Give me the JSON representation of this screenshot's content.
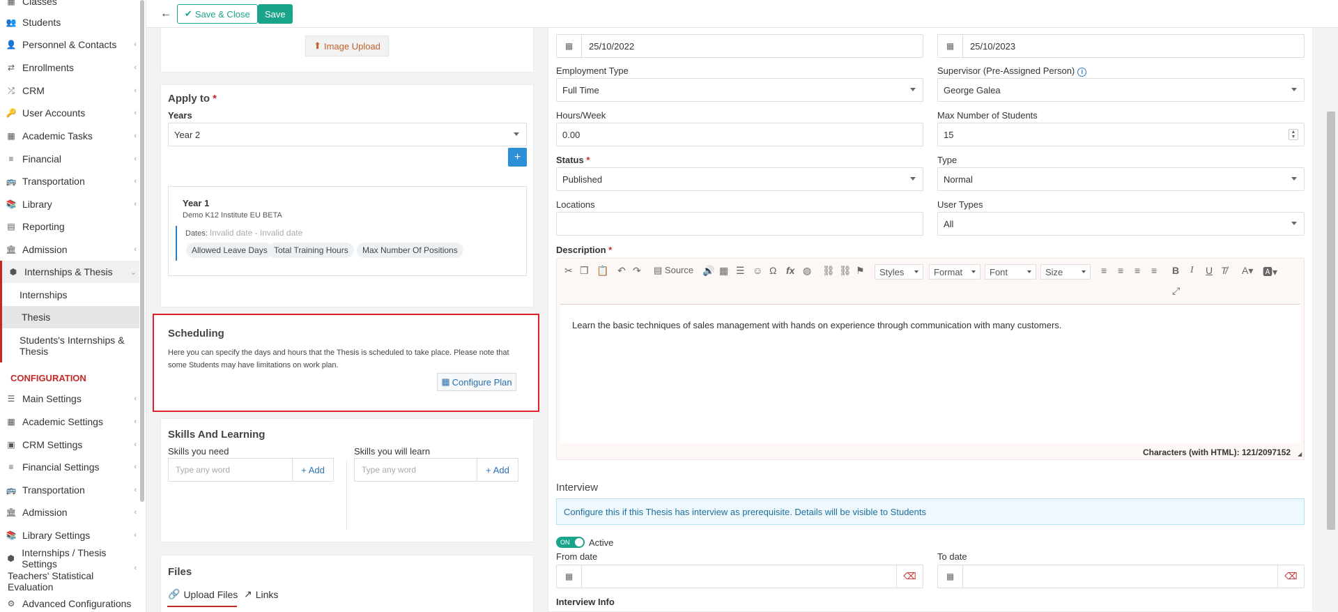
{
  "sidebar": {
    "top_partial_item": "Classes",
    "items": [
      {
        "label": "Students",
        "icon": "users-icon"
      },
      {
        "label": "Personnel & Contacts",
        "icon": "person-icon"
      },
      {
        "label": "Enrollments",
        "icon": "exchange-icon"
      },
      {
        "label": "CRM",
        "icon": "shuffle-icon"
      },
      {
        "label": "User Accounts",
        "icon": "key-icon"
      },
      {
        "label": "Academic Tasks",
        "icon": "grid-icon"
      },
      {
        "label": "Financial",
        "icon": "coins-icon"
      },
      {
        "label": "Transportation",
        "icon": "bus-icon"
      },
      {
        "label": "Library",
        "icon": "books-icon"
      },
      {
        "label": "Reporting",
        "icon": "report-icon"
      },
      {
        "label": "Admission",
        "icon": "bank-icon"
      },
      {
        "label": "Internships & Thesis",
        "icon": "cube-icon"
      }
    ],
    "sub_items": [
      "Internships",
      "Thesis",
      "Students's Internships &",
      "Thesis"
    ],
    "config_title": "CONFIGURATION",
    "config_items": [
      {
        "label": "Main Settings",
        "icon": "sliders-icon"
      },
      {
        "label": "Academic Settings",
        "icon": "grid-icon"
      },
      {
        "label": "CRM Settings",
        "icon": "crm-icon"
      },
      {
        "label": "Financial Settings",
        "icon": "coins-icon"
      },
      {
        "label": "Transportation",
        "icon": "bus-icon"
      },
      {
        "label": "Admission",
        "icon": "bank-icon"
      },
      {
        "label": "Library Settings",
        "icon": "books-icon"
      },
      {
        "label": "Internships / Thesis Settings",
        "icon": "cube-icon"
      },
      {
        "label": "Teachers' Statistical Evaluation",
        "icon": ""
      },
      {
        "label": "Advanced Configurations",
        "icon": "gears-icon"
      }
    ]
  },
  "toolbar": {
    "save_close_label": "Save & Close",
    "save_label": "Save"
  },
  "image_upload_label": "Image Upload",
  "apply_to": {
    "title": "Apply to",
    "years_label": "Years",
    "years_value": "Year 2",
    "card": {
      "title": "Year 1",
      "institute": "Demo K12 Institute EU BETA",
      "dates_label": "Dates:",
      "dates_value": "Invalid date - Invalid date",
      "chips": [
        "Allowed Leave Days",
        "Total Training Hours",
        "Max Number Of Positions"
      ]
    }
  },
  "scheduling": {
    "title": "Scheduling",
    "desc1": "Here you can specify the days and hours that the Thesis is scheduled to take place. Please note that",
    "desc2": "some Students may have limitations on work plan.",
    "configure_label": "Configure Plan"
  },
  "skills": {
    "title": "Skills And Learning",
    "need_label": "Skills you need",
    "learn_label": "Skills you will learn",
    "placeholder": "Type any word",
    "add_label": "Add"
  },
  "files": {
    "title": "Files",
    "tab_upload": "Upload Files",
    "tab_links": "Links"
  },
  "form": {
    "start_date": "25/10/2022",
    "end_date": "25/10/2023",
    "employment_type_label": "Employment Type",
    "employment_type_value": "Full Time",
    "supervisor_label": "Supervisor (Pre-Assigned Person)",
    "supervisor_value": "George Galea",
    "hours_label": "Hours/Week",
    "hours_value": "0.00",
    "max_students_label": "Max Number of Students",
    "max_students_value": "15",
    "status_label": "Status",
    "status_value": "Published",
    "type_label": "Type",
    "type_value": "Normal",
    "locations_label": "Locations",
    "user_types_label": "User Types",
    "user_types_value": "All",
    "description_label": "Description"
  },
  "editor": {
    "source_label": "Source",
    "styles_label": "Styles",
    "format_label": "Format",
    "font_label": "Font",
    "size_label": "Size",
    "text": "Learn the basic techniques of sales management with hands on experience through communication with many customers.",
    "char_count": "Characters (with HTML): 121/2097152"
  },
  "interview": {
    "title": "Interview",
    "info": "Configure this if this Thesis has interview as prerequisite. Details will be visible to Students",
    "toggle_label": "ON",
    "active_label": "Active",
    "from_label": "From date",
    "to_label": "To date",
    "info_label": "Interview Info"
  },
  "colors": {
    "accent": "#1aa58b",
    "danger": "#c62828",
    "link": "#2a6fb0"
  }
}
